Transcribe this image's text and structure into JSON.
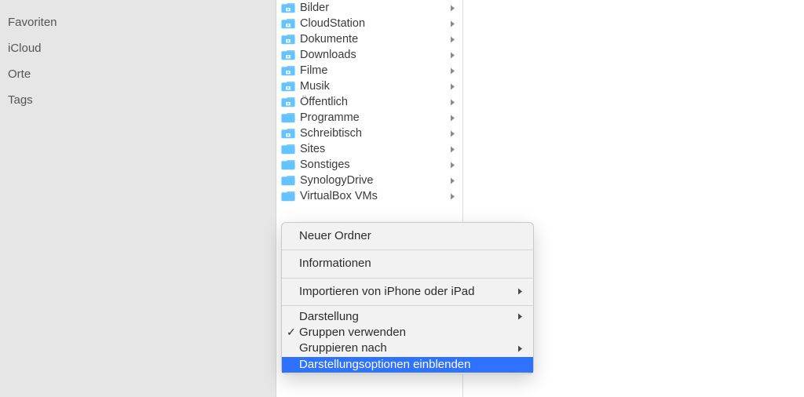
{
  "sidebar": {
    "sections": [
      {
        "label": "Favoriten"
      },
      {
        "label": "iCloud"
      },
      {
        "label": "Orte"
      },
      {
        "label": "Tags"
      }
    ]
  },
  "folders": [
    {
      "name": "Bilder",
      "iconType": "special",
      "hasChildren": true
    },
    {
      "name": "CloudStation",
      "iconType": "special",
      "hasChildren": true
    },
    {
      "name": "Dokumente",
      "iconType": "special",
      "hasChildren": true
    },
    {
      "name": "Downloads",
      "iconType": "special",
      "hasChildren": true
    },
    {
      "name": "Filme",
      "iconType": "special",
      "hasChildren": true
    },
    {
      "name": "Musik",
      "iconType": "special",
      "hasChildren": true
    },
    {
      "name": "Öffentlich",
      "iconType": "special",
      "hasChildren": true
    },
    {
      "name": "Programme",
      "iconType": "plain",
      "hasChildren": true
    },
    {
      "name": "Schreibtisch",
      "iconType": "special",
      "hasChildren": true
    },
    {
      "name": "Sites",
      "iconType": "plain",
      "hasChildren": true
    },
    {
      "name": "Sonstiges",
      "iconType": "plain",
      "hasChildren": true
    },
    {
      "name": "SynologyDrive",
      "iconType": "plain",
      "hasChildren": true
    },
    {
      "name": "VirtualBox VMs",
      "iconType": "plain",
      "hasChildren": true
    }
  ],
  "contextMenu": {
    "items": [
      {
        "label": "Neuer Ordner",
        "type": "item"
      },
      {
        "type": "separator"
      },
      {
        "label": "Informationen",
        "type": "item"
      },
      {
        "type": "separator"
      },
      {
        "label": "Importieren von iPhone oder iPad",
        "type": "item",
        "submenu": true
      },
      {
        "type": "separator"
      },
      {
        "label": "Darstellung",
        "type": "item",
        "submenu": true,
        "compact": true
      },
      {
        "label": "Gruppen verwenden",
        "type": "item",
        "checked": true,
        "compact": true
      },
      {
        "label": "Gruppieren nach",
        "type": "item",
        "submenu": true,
        "compact": true
      },
      {
        "label": "Darstellungsoptionen einblenden",
        "type": "item",
        "selected": true,
        "compact": true
      }
    ]
  },
  "colors": {
    "folderBlue": "#63c4ff",
    "selectionBlue": "#2f72ff",
    "sidebarBg": "#e6e6e6"
  }
}
